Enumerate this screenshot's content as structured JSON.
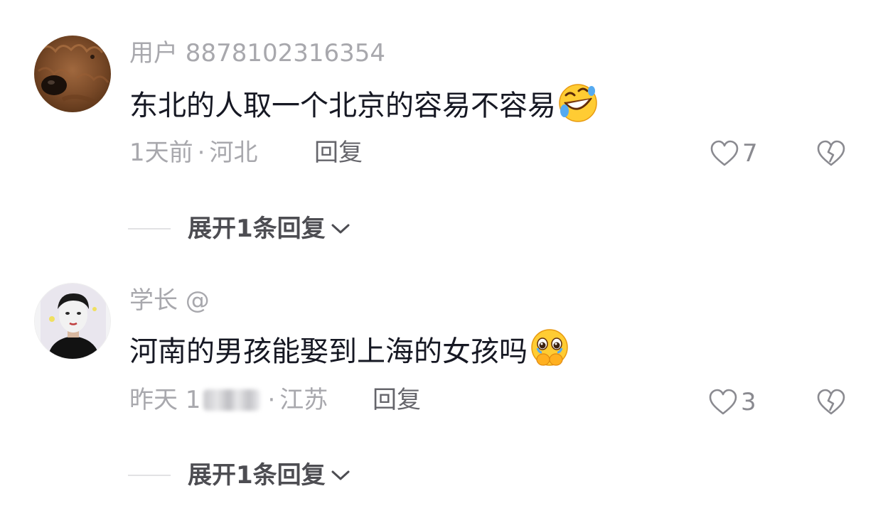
{
  "comments": [
    {
      "username": "用户 8878102316354",
      "content": "东北的人取一个北京的容易不容易",
      "emoji": "rolling-laughing-emoji",
      "time": "1天前",
      "separator": "·",
      "location": "河北",
      "reply_label": "回复",
      "like_count": "7",
      "expand_label": "展开1条回复"
    },
    {
      "username": "学长 @",
      "content": "河南的男孩能娶到上海的女孩吗",
      "emoji": "pleading-face-emoji",
      "time_prefix": "昨天 1",
      "separator": "·",
      "location": "江苏",
      "reply_label": "回复",
      "like_count": "3",
      "expand_label": "展开1条回复"
    }
  ],
  "colors": {
    "text_primary": "#161823",
    "text_secondary": "#a8a8ad",
    "reply_text": "#65656b",
    "expand_text": "#4d4d52",
    "divider": "#e2e2e4"
  }
}
